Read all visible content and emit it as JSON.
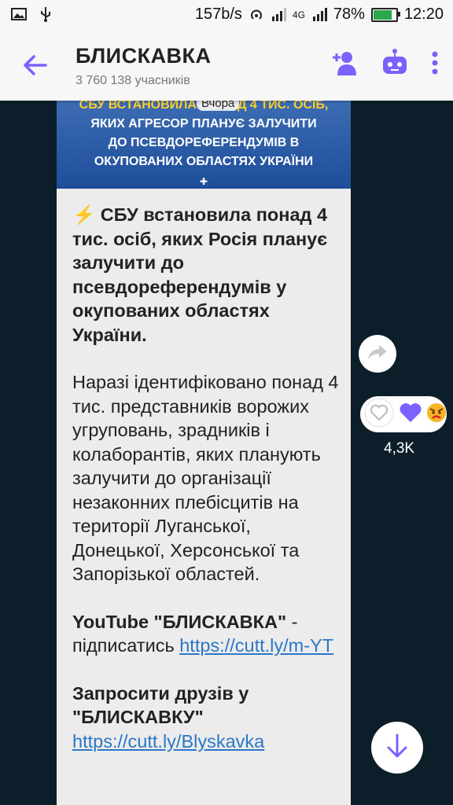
{
  "status": {
    "speed": "157b/s",
    "network": "4G",
    "battery": "78%",
    "time": "12:20"
  },
  "header": {
    "title": "БЛИСКАВКА",
    "subtitle": "3 760 138 учасників"
  },
  "banner": {
    "line1": "СБУ ВСТАНОВИЛА ПОНАД 4 ТИС. ОСІБ,",
    "line2": "ЯКИХ АГРЕСОР ПЛАНУЄ ЗАЛУЧИТИ",
    "line3": "ДО ПСЕВДОРЕФЕРЕНДУМІВ В",
    "line4": "ОКУПОВАНИХ ОБЛАСТЯХ УКРАЇНИ",
    "date_label": "Вчора"
  },
  "message": {
    "headline_icon": "⚡",
    "headline": "СБУ встановила понад 4 тис. осіб, яких Росія планує залучити до псевдореферендумів у окупованих областях України.",
    "para2": "Наразі ідентифіковано понад 4 тис. представників ворожих угруповань, зрадників і колаборантів, яких планують залучити до організації незаконних плебісцитів на території Луганської, Донецької, Херсонської та Запорізької областей.",
    "yt_title": "YouTube \"БЛИСКАВКА\"",
    "yt_suffix": " - підписатись ",
    "yt_link": "https://cutt.ly/m-YT",
    "invite_title": "Запросити друзів у \"БЛИСКАВКУ\"",
    "invite_link": "https://cutt.ly/Blyskavka"
  },
  "reactions": {
    "count": "4,3K"
  },
  "colors": {
    "accent": "#7b61ff",
    "link": "#2b77c7"
  }
}
